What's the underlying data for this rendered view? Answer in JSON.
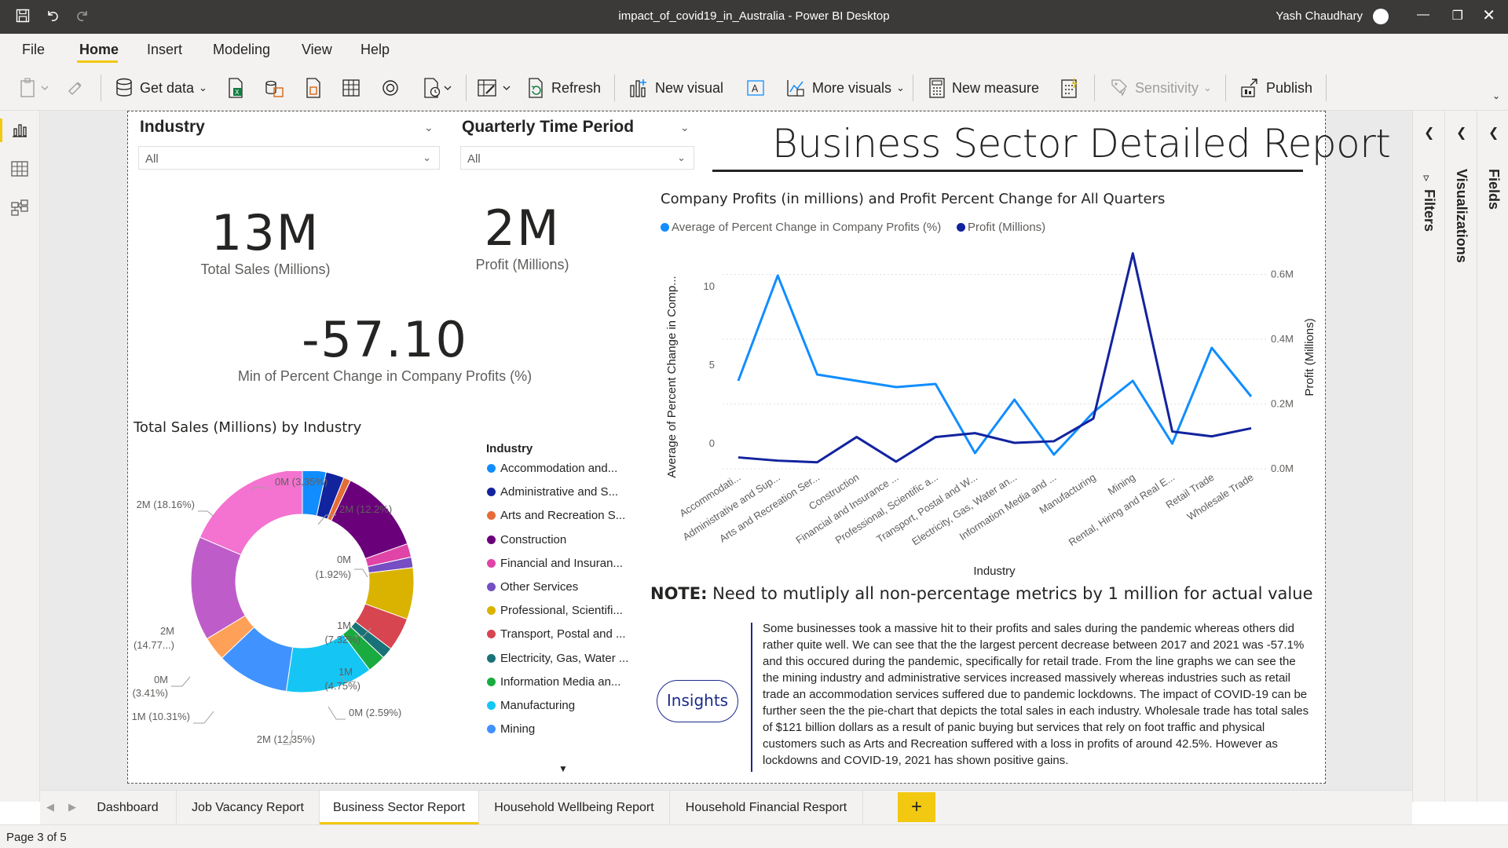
{
  "window": {
    "title": "impact_of_covid19_in_Australia - Power BI Desktop",
    "user": "Yash Chaudhary"
  },
  "menu": [
    "File",
    "Home",
    "Insert",
    "Modeling",
    "View",
    "Help"
  ],
  "ribbon": {
    "get_data": "Get data",
    "refresh": "Refresh",
    "new_visual": "New visual",
    "more_visuals": "More visuals",
    "new_measure": "New measure",
    "sensitivity": "Sensitivity",
    "publish": "Publish"
  },
  "slicers": {
    "industry": {
      "title": "Industry",
      "value": "All"
    },
    "quarter": {
      "title": "Quarterly Time Period",
      "value": "All"
    }
  },
  "report_title": "Business Sector Detailed Report",
  "kpis": {
    "total_sales": {
      "value": "13M",
      "label": "Total Sales (Millions)"
    },
    "profit": {
      "value": "2M",
      "label": "Profit (Millions)"
    },
    "min_change": {
      "value": "-57.10",
      "label": "Min of Percent Change in Company Profits (%)"
    }
  },
  "pie_title": "Total Sales (Millions) by Industry",
  "line_title": "Company Profits (in millions) and Profit Percent Change for All Quarters",
  "right_panes": {
    "filters": "Filters",
    "visualizations": "Visualizations",
    "fields": "Fields"
  },
  "note": {
    "bold": "NOTE:",
    "text": " Need to mutliply all non-percentage metrics by 1 million for actual value"
  },
  "insights": {
    "button": "Insights",
    "text": "Some businesses took a massive hit to their profits and sales during the pandemic whereas others did rather quite well. We can see that the the largest percent decrease between 2017 and 2021 was -57.1% and this occured during the pandemic, specifically for retail trade. From the line graphs we can see the the mining industry and administrative services increased massively whereas industries such as retail trade an accommodation services suffered due to pandemic lockdowns. The impact of COVID-19 can be further seen the the pie-chart that depicts the total sales in each industry. Wholesale trade has total sales of $121 billion dollars as a result of panic buying but services that rely on foot traffic and physical customers such as Arts and Recreation suffered with a loss in profits of around 42.5%. However as lockdowns and COVID-19, 2021 has shown positive gains."
  },
  "tabs": [
    "Dashboard",
    "Job Vacancy Report",
    "Business Sector Report",
    "Household Wellbeing Report",
    "Household Financial Resport"
  ],
  "tab_add": "+",
  "active_tab": 2,
  "status": "Page 3 of 5",
  "colors": {
    "accent": "#f2c811",
    "line_light": "#118dff",
    "line_dark": "#12239e"
  },
  "chart_data": [
    {
      "type": "pie",
      "title": "Total Sales (Millions) by Industry",
      "legend_title": "Industry",
      "legend": [
        "Accommodation and...",
        "Administrative and S...",
        "Arts and Recreation S...",
        "Construction",
        "Financial and Insuran...",
        "Other Services",
        "Professional, Scientifi...",
        "Transport, Postal and ...",
        "Electricity, Gas, Water ...",
        "Information Media an...",
        "Manufacturing",
        "Mining"
      ],
      "slices": [
        {
          "name": "Accommodation",
          "percent": 3.35,
          "color": "#118dff"
        },
        {
          "name": "Administrative",
          "percent": 2.6,
          "color": "#12239e"
        },
        {
          "name": "Arts and Recreation",
          "percent": 1.0,
          "color": "#e66c37"
        },
        {
          "name": "Construction",
          "percent": 12.2,
          "color": "#6b007b"
        },
        {
          "name": "Financial and Insurance",
          "percent": 1.92,
          "color": "#e044a7"
        },
        {
          "name": "Other Services",
          "percent": 1.5,
          "color": "#744ec2"
        },
        {
          "name": "Professional, Scientific",
          "percent": 7.32,
          "color": "#d9b300"
        },
        {
          "name": "Transport, Postal",
          "percent": 4.75,
          "color": "#d64550"
        },
        {
          "name": "Electricity, Gas, Water",
          "percent": 1.6,
          "color": "#197278"
        },
        {
          "name": "Information Media",
          "percent": 2.59,
          "color": "#1aab40"
        },
        {
          "name": "Manufacturing",
          "percent": 12.35,
          "color": "#15c6f4"
        },
        {
          "name": "Mining",
          "percent": 10.31,
          "color": "#4092ff"
        },
        {
          "name": "Rental, Hiring",
          "percent": 3.41,
          "color": "#ffa058"
        },
        {
          "name": "Retail Trade",
          "percent": 14.77,
          "color": "#be5dc9"
        },
        {
          "name": "Wholesale Trade",
          "percent": 18.16,
          "color": "#f472d0"
        }
      ],
      "labels": [
        "0M (3.35%)",
        "2M (12.2%)",
        "0M",
        "(1.92%)",
        "1M",
        "(7.32%)",
        "1M",
        "(4.75%)",
        "0M (2.59%)",
        "2M (12.35%)",
        "1M (10.31%)",
        "0M",
        "(3.41%)",
        "2M",
        "(14.77...)",
        "2M (18.16%)"
      ]
    },
    {
      "type": "line",
      "title": "Company Profits (in millions) and Profit Percent Change for All Quarters",
      "categories": [
        "Accommodati...",
        "Administrative and Sup...",
        "Arts and Recreation Ser...",
        "Construction",
        "Financial and Insurance ...",
        "Professional, Scientific a...",
        "Transport, Postal and W...",
        "Electricity, Gas, Water an...",
        "Information Media and ...",
        "Manufacturing",
        "Mining",
        "Rental, Hiring and Real E...",
        "Retail Trade",
        "Wholesale Trade"
      ],
      "xlabel": "Industry",
      "ylabel": "Average of Percent Change in Comp...",
      "y2label": "Profit (Millions)",
      "ylim": [
        -2,
        12
      ],
      "y2lim": [
        0,
        0.72
      ],
      "y_ticks": [
        "10",
        "5",
        "0"
      ],
      "y2_ticks": [
        "0.6M",
        "0.4M",
        "0.2M",
        "0.0M"
      ],
      "legend_labels": [
        "Average of Percent Change in Company Profits (%)",
        "Profit (Millions)"
      ],
      "series": [
        {
          "name": "Average of Percent Change in Company Profits (%)",
          "axis": "left",
          "color": "#118dff",
          "values": [
            4.0,
            10.7,
            4.4,
            4.0,
            3.6,
            3.8,
            -0.6,
            2.8,
            -0.7,
            2.0,
            4.0,
            0.0,
            6.1,
            3.0
          ]
        },
        {
          "name": "Profit (Millions)",
          "axis": "right",
          "color": "#12239e",
          "values": [
            0.035,
            0.025,
            0.02,
            0.098,
            0.022,
            0.098,
            0.11,
            0.08,
            0.085,
            0.155,
            0.665,
            0.115,
            0.1,
            0.125
          ]
        }
      ]
    }
  ]
}
